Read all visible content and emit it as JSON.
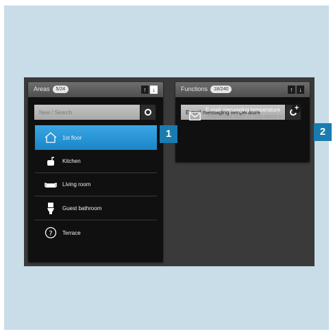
{
  "areas_panel": {
    "title": "Areas",
    "count": "5/24",
    "search_placeholder": "New / Search",
    "items": [
      {
        "label": "1st floor",
        "icon": "house-icon",
        "selected": true
      },
      {
        "label": "Kitchen",
        "icon": "pot-icon",
        "selected": false
      },
      {
        "label": "Living room",
        "icon": "sofa-icon",
        "selected": false
      },
      {
        "label": "Guest bathroom",
        "icon": "toilet-icon",
        "selected": false
      },
      {
        "label": "Terrace",
        "icon": "question-icon",
        "selected": false
      }
    ]
  },
  "functions_panel": {
    "title": "Functions",
    "count": "18/240",
    "search_value": "E-mail messaging temperature",
    "item": {
      "title": "E-mail messaging temperature",
      "description": "Temperature drops or rises above or",
      "icon": "envelope-icon"
    }
  },
  "sort_labels": {
    "up": "↑",
    "down": "↓"
  },
  "callouts": [
    "1",
    "2"
  ],
  "colors": {
    "accent": "#1a86c8",
    "callout": "#1a7bb0",
    "background": "#c9dde8"
  }
}
